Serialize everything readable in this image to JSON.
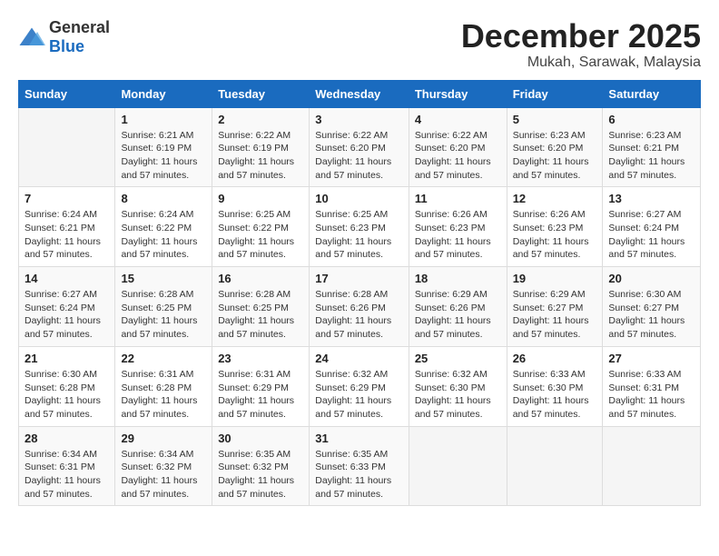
{
  "logo": {
    "general": "General",
    "blue": "Blue"
  },
  "title": {
    "month_year": "December 2025",
    "location": "Mukah, Sarawak, Malaysia"
  },
  "headers": [
    "Sunday",
    "Monday",
    "Tuesday",
    "Wednesday",
    "Thursday",
    "Friday",
    "Saturday"
  ],
  "weeks": [
    [
      {
        "day": "",
        "info": ""
      },
      {
        "day": "1",
        "info": "Sunrise: 6:21 AM\nSunset: 6:19 PM\nDaylight: 11 hours and 57 minutes."
      },
      {
        "day": "2",
        "info": "Sunrise: 6:22 AM\nSunset: 6:19 PM\nDaylight: 11 hours and 57 minutes."
      },
      {
        "day": "3",
        "info": "Sunrise: 6:22 AM\nSunset: 6:20 PM\nDaylight: 11 hours and 57 minutes."
      },
      {
        "day": "4",
        "info": "Sunrise: 6:22 AM\nSunset: 6:20 PM\nDaylight: 11 hours and 57 minutes."
      },
      {
        "day": "5",
        "info": "Sunrise: 6:23 AM\nSunset: 6:20 PM\nDaylight: 11 hours and 57 minutes."
      },
      {
        "day": "6",
        "info": "Sunrise: 6:23 AM\nSunset: 6:21 PM\nDaylight: 11 hours and 57 minutes."
      }
    ],
    [
      {
        "day": "7",
        "info": "Sunrise: 6:24 AM\nSunset: 6:21 PM\nDaylight: 11 hours and 57 minutes."
      },
      {
        "day": "8",
        "info": "Sunrise: 6:24 AM\nSunset: 6:22 PM\nDaylight: 11 hours and 57 minutes."
      },
      {
        "day": "9",
        "info": "Sunrise: 6:25 AM\nSunset: 6:22 PM\nDaylight: 11 hours and 57 minutes."
      },
      {
        "day": "10",
        "info": "Sunrise: 6:25 AM\nSunset: 6:23 PM\nDaylight: 11 hours and 57 minutes."
      },
      {
        "day": "11",
        "info": "Sunrise: 6:26 AM\nSunset: 6:23 PM\nDaylight: 11 hours and 57 minutes."
      },
      {
        "day": "12",
        "info": "Sunrise: 6:26 AM\nSunset: 6:23 PM\nDaylight: 11 hours and 57 minutes."
      },
      {
        "day": "13",
        "info": "Sunrise: 6:27 AM\nSunset: 6:24 PM\nDaylight: 11 hours and 57 minutes."
      }
    ],
    [
      {
        "day": "14",
        "info": "Sunrise: 6:27 AM\nSunset: 6:24 PM\nDaylight: 11 hours and 57 minutes."
      },
      {
        "day": "15",
        "info": "Sunrise: 6:28 AM\nSunset: 6:25 PM\nDaylight: 11 hours and 57 minutes."
      },
      {
        "day": "16",
        "info": "Sunrise: 6:28 AM\nSunset: 6:25 PM\nDaylight: 11 hours and 57 minutes."
      },
      {
        "day": "17",
        "info": "Sunrise: 6:28 AM\nSunset: 6:26 PM\nDaylight: 11 hours and 57 minutes."
      },
      {
        "day": "18",
        "info": "Sunrise: 6:29 AM\nSunset: 6:26 PM\nDaylight: 11 hours and 57 minutes."
      },
      {
        "day": "19",
        "info": "Sunrise: 6:29 AM\nSunset: 6:27 PM\nDaylight: 11 hours and 57 minutes."
      },
      {
        "day": "20",
        "info": "Sunrise: 6:30 AM\nSunset: 6:27 PM\nDaylight: 11 hours and 57 minutes."
      }
    ],
    [
      {
        "day": "21",
        "info": "Sunrise: 6:30 AM\nSunset: 6:28 PM\nDaylight: 11 hours and 57 minutes."
      },
      {
        "day": "22",
        "info": "Sunrise: 6:31 AM\nSunset: 6:28 PM\nDaylight: 11 hours and 57 minutes."
      },
      {
        "day": "23",
        "info": "Sunrise: 6:31 AM\nSunset: 6:29 PM\nDaylight: 11 hours and 57 minutes."
      },
      {
        "day": "24",
        "info": "Sunrise: 6:32 AM\nSunset: 6:29 PM\nDaylight: 11 hours and 57 minutes."
      },
      {
        "day": "25",
        "info": "Sunrise: 6:32 AM\nSunset: 6:30 PM\nDaylight: 11 hours and 57 minutes."
      },
      {
        "day": "26",
        "info": "Sunrise: 6:33 AM\nSunset: 6:30 PM\nDaylight: 11 hours and 57 minutes."
      },
      {
        "day": "27",
        "info": "Sunrise: 6:33 AM\nSunset: 6:31 PM\nDaylight: 11 hours and 57 minutes."
      }
    ],
    [
      {
        "day": "28",
        "info": "Sunrise: 6:34 AM\nSunset: 6:31 PM\nDaylight: 11 hours and 57 minutes."
      },
      {
        "day": "29",
        "info": "Sunrise: 6:34 AM\nSunset: 6:32 PM\nDaylight: 11 hours and 57 minutes."
      },
      {
        "day": "30",
        "info": "Sunrise: 6:35 AM\nSunset: 6:32 PM\nDaylight: 11 hours and 57 minutes."
      },
      {
        "day": "31",
        "info": "Sunrise: 6:35 AM\nSunset: 6:33 PM\nDaylight: 11 hours and 57 minutes."
      },
      {
        "day": "",
        "info": ""
      },
      {
        "day": "",
        "info": ""
      },
      {
        "day": "",
        "info": ""
      }
    ]
  ]
}
